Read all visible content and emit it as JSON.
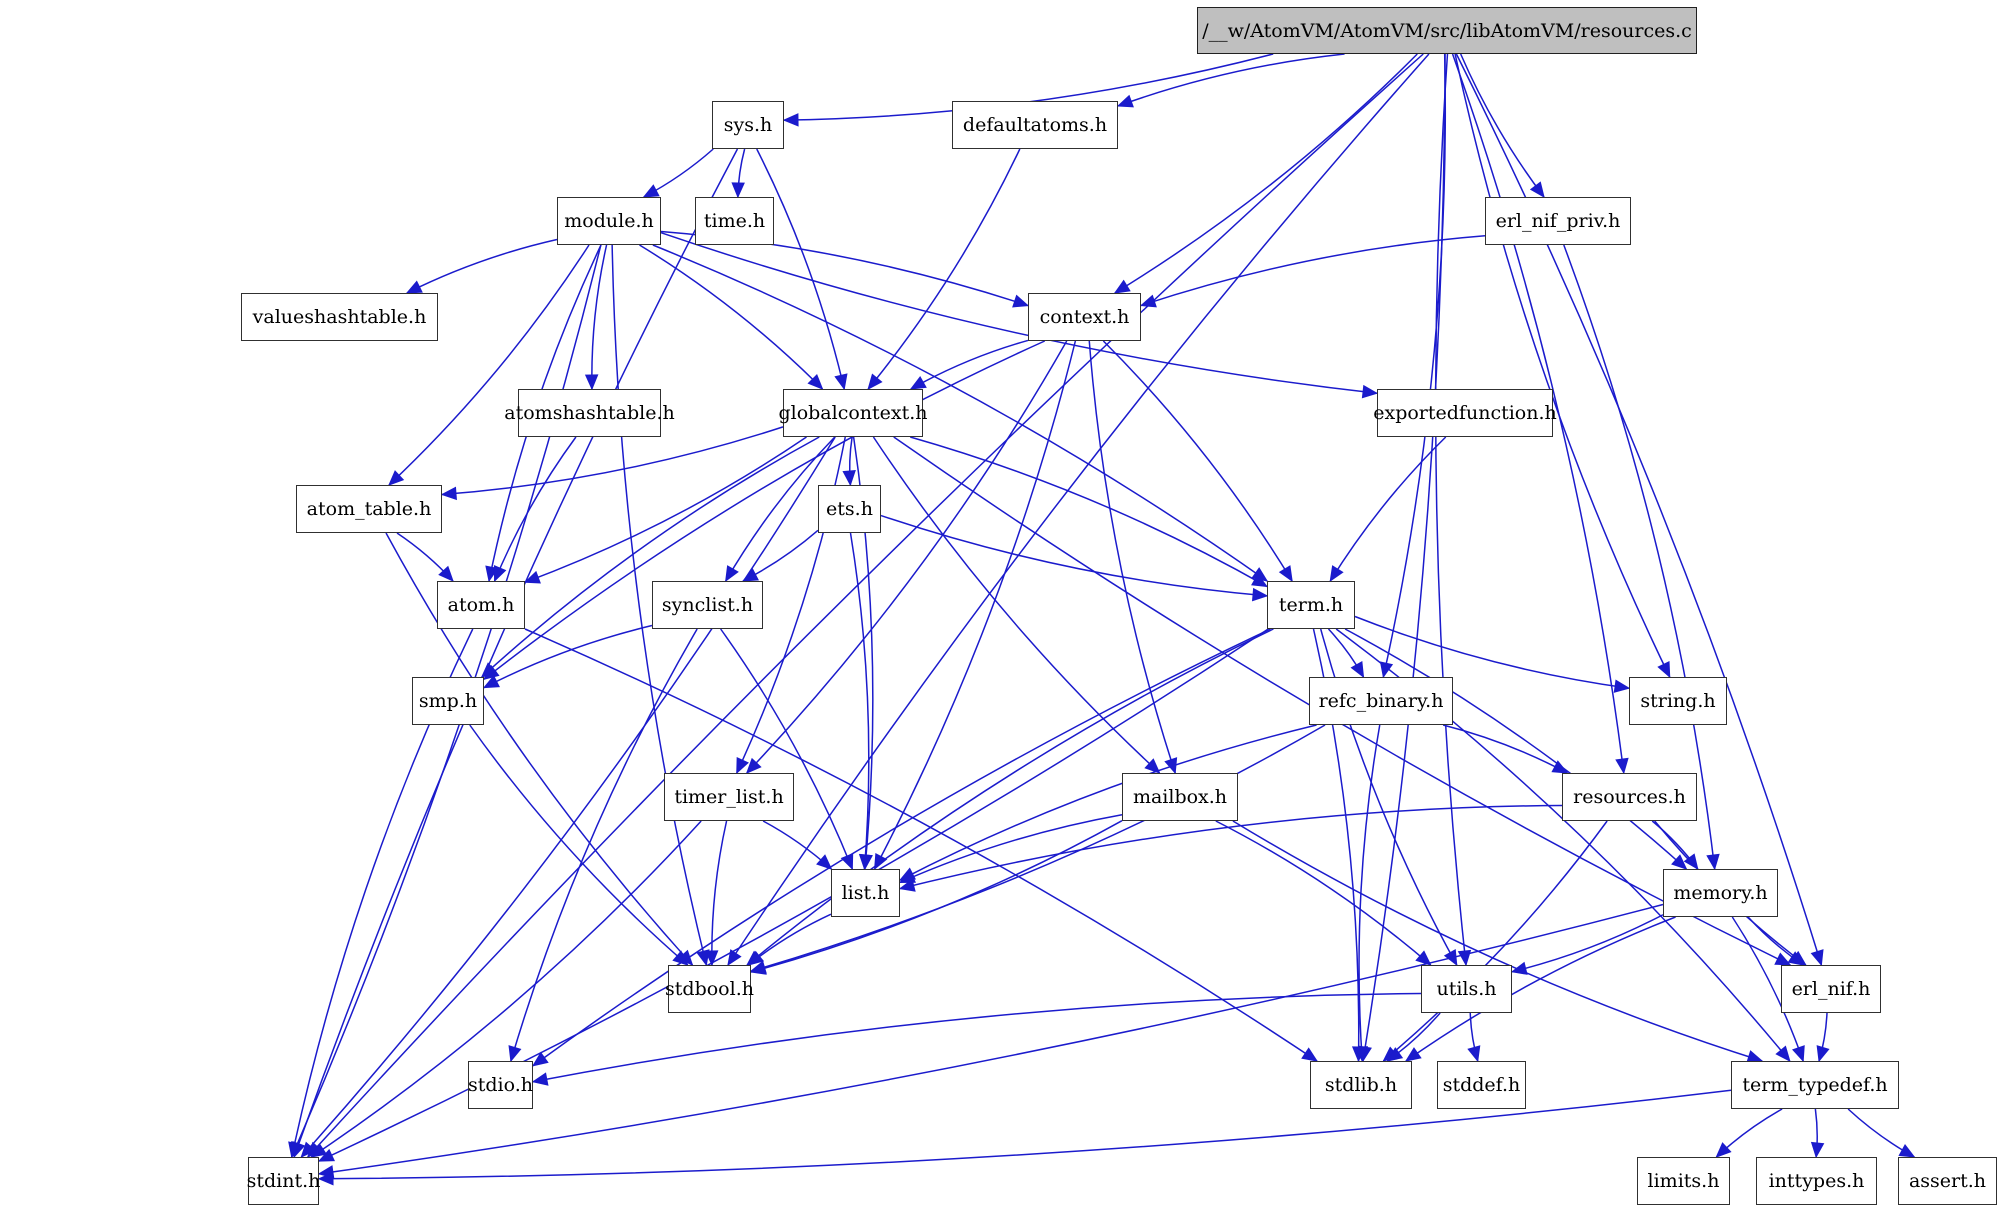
{
  "graph": {
    "title": "/__w/AtomVM/AtomVM/src/libAtomVM/resources.c",
    "colors": {
      "edge": "#1b1bcc",
      "root_fill": "#bfbfbf",
      "node_fill": "#ffffff",
      "border": "#303030"
    },
    "nodes": {
      "root": "/__w/AtomVM/AtomVM/src/libAtomVM/resources.c",
      "sys_h": "sys.h",
      "defaultatoms_h": "defaultatoms.h",
      "module_h": "module.h",
      "time_h": "time.h",
      "erl_nif_priv_h": "erl_nif_priv.h",
      "valueshashtable_h": "valueshashtable.h",
      "context_h": "context.h",
      "atomshashtable_h": "atomshashtable.h",
      "globalcontext_h": "globalcontext.h",
      "exportedfunction_h": "exportedfunction.h",
      "atom_table_h": "atom_table.h",
      "ets_h": "ets.h",
      "atom_h": "atom.h",
      "synclist_h": "synclist.h",
      "term_h": "term.h",
      "smp_h": "smp.h",
      "refc_binary_h": "refc_binary.h",
      "string_h": "string.h",
      "timer_list_h": "timer_list.h",
      "mailbox_h": "mailbox.h",
      "resources_h": "resources.h",
      "list_h": "list.h",
      "memory_h": "memory.h",
      "stdbool_h": "stdbool.h",
      "utils_h": "utils.h",
      "erl_nif_h": "erl_nif.h",
      "stdio_h": "stdio.h",
      "stdlib_h": "stdlib.h",
      "stddef_h": "stddef.h",
      "term_typedef_h": "term_typedef.h",
      "stdint_h": "stdint.h",
      "limits_h": "limits.h",
      "inttypes_h": "inttypes.h",
      "assert_h": "assert.h"
    },
    "edges": [
      [
        "root",
        "sys_h"
      ],
      [
        "root",
        "defaultatoms_h"
      ],
      [
        "root",
        "context_h"
      ],
      [
        "root",
        "erl_nif_priv_h"
      ],
      [
        "root",
        "refc_binary_h"
      ],
      [
        "root",
        "string_h"
      ],
      [
        "root",
        "resources_h"
      ],
      [
        "root",
        "utils_h"
      ],
      [
        "root",
        "erl_nif_h"
      ],
      [
        "root",
        "stdbool_h"
      ],
      [
        "root",
        "stdlib_h"
      ],
      [
        "root",
        "stdint_h"
      ],
      [
        "sys_h",
        "module_h"
      ],
      [
        "sys_h",
        "time_h"
      ],
      [
        "sys_h",
        "globalcontext_h"
      ],
      [
        "sys_h",
        "stdint_h"
      ],
      [
        "defaultatoms_h",
        "globalcontext_h"
      ],
      [
        "module_h",
        "valueshashtable_h"
      ],
      [
        "module_h",
        "context_h"
      ],
      [
        "module_h",
        "atomshashtable_h"
      ],
      [
        "module_h",
        "globalcontext_h"
      ],
      [
        "module_h",
        "exportedfunction_h"
      ],
      [
        "module_h",
        "atom_table_h"
      ],
      [
        "module_h",
        "atom_h"
      ],
      [
        "module_h",
        "term_h"
      ],
      [
        "module_h",
        "stdbool_h"
      ],
      [
        "module_h",
        "stdint_h"
      ],
      [
        "erl_nif_priv_h",
        "context_h"
      ],
      [
        "erl_nif_priv_h",
        "memory_h"
      ],
      [
        "context_h",
        "globalcontext_h"
      ],
      [
        "context_h",
        "term_h"
      ],
      [
        "context_h",
        "smp_h"
      ],
      [
        "context_h",
        "timer_list_h"
      ],
      [
        "context_h",
        "mailbox_h"
      ],
      [
        "context_h",
        "list_h"
      ],
      [
        "atomshashtable_h",
        "atom_h"
      ],
      [
        "globalcontext_h",
        "atom_table_h"
      ],
      [
        "globalcontext_h",
        "ets_h"
      ],
      [
        "globalcontext_h",
        "atom_h"
      ],
      [
        "globalcontext_h",
        "synclist_h"
      ],
      [
        "globalcontext_h",
        "term_h"
      ],
      [
        "globalcontext_h",
        "smp_h"
      ],
      [
        "globalcontext_h",
        "timer_list_h"
      ],
      [
        "globalcontext_h",
        "mailbox_h"
      ],
      [
        "globalcontext_h",
        "list_h"
      ],
      [
        "globalcontext_h",
        "erl_nif_h"
      ],
      [
        "globalcontext_h",
        "stdint_h"
      ],
      [
        "exportedfunction_h",
        "term_h"
      ],
      [
        "atom_table_h",
        "atom_h"
      ],
      [
        "atom_table_h",
        "stdbool_h"
      ],
      [
        "ets_h",
        "synclist_h"
      ],
      [
        "ets_h",
        "term_h"
      ],
      [
        "ets_h",
        "list_h"
      ],
      [
        "atom_h",
        "stdint_h"
      ],
      [
        "atom_h",
        "stdlib_h"
      ],
      [
        "synclist_h",
        "smp_h"
      ],
      [
        "synclist_h",
        "list_h"
      ],
      [
        "synclist_h",
        "stdio_h"
      ],
      [
        "term_h",
        "refc_binary_h"
      ],
      [
        "term_h",
        "string_h"
      ],
      [
        "term_h",
        "memory_h"
      ],
      [
        "term_h",
        "utils_h"
      ],
      [
        "term_h",
        "term_typedef_h"
      ],
      [
        "term_h",
        "stdbool_h"
      ],
      [
        "term_h",
        "stdlib_h"
      ],
      [
        "term_h",
        "stdio_h"
      ],
      [
        "term_h",
        "stdint_h"
      ],
      [
        "smp_h",
        "stdbool_h"
      ],
      [
        "refc_binary_h",
        "resources_h"
      ],
      [
        "refc_binary_h",
        "list_h"
      ],
      [
        "refc_binary_h",
        "stdbool_h"
      ],
      [
        "refc_binary_h",
        "stdlib_h"
      ],
      [
        "timer_list_h",
        "list_h"
      ],
      [
        "timer_list_h",
        "stdbool_h"
      ],
      [
        "timer_list_h",
        "stdint_h"
      ],
      [
        "mailbox_h",
        "list_h"
      ],
      [
        "mailbox_h",
        "utils_h"
      ],
      [
        "mailbox_h",
        "term_typedef_h"
      ],
      [
        "mailbox_h",
        "stdbool_h"
      ],
      [
        "resources_h",
        "list_h"
      ],
      [
        "resources_h",
        "memory_h"
      ],
      [
        "resources_h",
        "erl_nif_h"
      ],
      [
        "resources_h",
        "stdlib_h"
      ],
      [
        "list_h",
        "stdbool_h"
      ],
      [
        "memory_h",
        "utils_h"
      ],
      [
        "memory_h",
        "erl_nif_h"
      ],
      [
        "memory_h",
        "term_typedef_h"
      ],
      [
        "memory_h",
        "stdlib_h"
      ],
      [
        "memory_h",
        "stdint_h"
      ],
      [
        "utils_h",
        "stdio_h"
      ],
      [
        "utils_h",
        "stdlib_h"
      ],
      [
        "utils_h",
        "stddef_h"
      ],
      [
        "erl_nif_h",
        "term_typedef_h"
      ],
      [
        "term_typedef_h",
        "limits_h"
      ],
      [
        "term_typedef_h",
        "inttypes_h"
      ],
      [
        "term_typedef_h",
        "assert_h"
      ],
      [
        "term_typedef_h",
        "stdint_h"
      ]
    ]
  }
}
